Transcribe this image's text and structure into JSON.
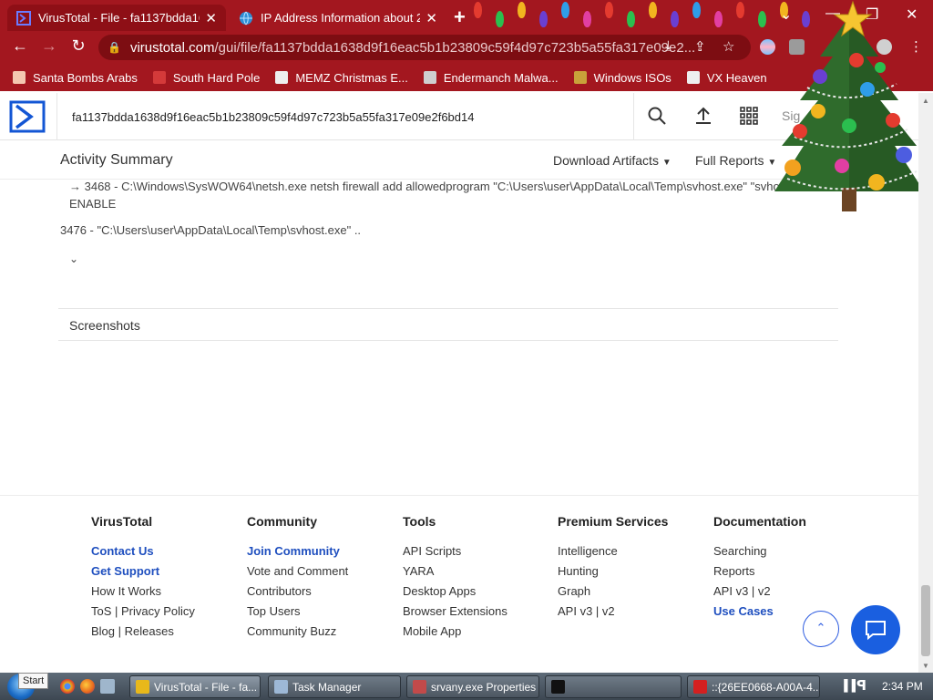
{
  "browser": {
    "tabs": [
      {
        "title": "VirusTotal - File - fa1137bdda163",
        "active": true
      },
      {
        "title": "IP Address Information about 20",
        "active": false
      }
    ],
    "new_tab": "+",
    "window_controls": {
      "minimize": "—",
      "maximize": "❐",
      "close": "✕",
      "dropdown": "⌄"
    },
    "nav": {
      "back": "←",
      "forward": "→",
      "reload": "↻"
    },
    "url_domain": "virustotal.com",
    "url_rest": "/gui/file/fa1137bdda1638d9f16eac5b1b23809c59f4d97c723b5a55fa317e09e2...",
    "bookmarks": [
      {
        "label": "Santa Bombs Arabs",
        "icon": "santa-icon",
        "color": "#f4c7b0"
      },
      {
        "label": "South Hard Pole",
        "icon": "snowflake-icon",
        "color": "#d43a3a"
      },
      {
        "label": "MEMZ Christmas E...",
        "icon": "page-icon",
        "color": "#eeeeee"
      },
      {
        "label": "Endermanch Malwa...",
        "icon": "panda-icon",
        "color": "#cfcfcf"
      },
      {
        "label": "Windows ISOs",
        "icon": "trophy-icon",
        "color": "#c9a23a"
      },
      {
        "label": "VX Heaven",
        "icon": "spider-icon",
        "color": "#eeeeee"
      }
    ]
  },
  "vt": {
    "search_value": "fa1137bdda1638d9f16eac5b1b23809c59f4d97c723b5a55fa317e09e2f6bd14",
    "signin": "Sig",
    "activity_title": "Activity Summary",
    "download_artifacts": "Download Artifacts",
    "full_reports": "Full Reports",
    "process_line1": "→ 3468 - C:\\Windows\\SysWOW64\\netsh.exe netsh firewall add allowedprogram \"C:\\Users\\user\\AppData\\Local\\Temp\\svhost.exe\" \"svhos",
    "process_line1b": "ENABLE",
    "process_line2": "3476 - \"C:\\Users\\user\\AppData\\Local\\Temp\\svhost.exe\" ..",
    "expand": "⌄",
    "screenshots": "Screenshots"
  },
  "footer": {
    "columns": [
      {
        "heading": "VirusTotal",
        "links": [
          {
            "label": "Contact Us",
            "highlight": true
          },
          {
            "label": "Get Support",
            "highlight": true
          },
          {
            "label": "How It Works",
            "highlight": false
          },
          {
            "label": "ToS | Privacy Policy",
            "highlight": false
          },
          {
            "label": "Blog | Releases",
            "highlight": false
          }
        ]
      },
      {
        "heading": "Community",
        "links": [
          {
            "label": "Join Community",
            "highlight": true
          },
          {
            "label": "Vote and Comment",
            "highlight": false
          },
          {
            "label": "Contributors",
            "highlight": false
          },
          {
            "label": "Top Users",
            "highlight": false
          },
          {
            "label": "Community Buzz",
            "highlight": false
          }
        ]
      },
      {
        "heading": "Tools",
        "links": [
          {
            "label": "API Scripts",
            "highlight": false
          },
          {
            "label": "YARA",
            "highlight": false
          },
          {
            "label": "Desktop Apps",
            "highlight": false
          },
          {
            "label": "Browser Extensions",
            "highlight": false
          },
          {
            "label": "Mobile App",
            "highlight": false
          }
        ]
      },
      {
        "heading": "Premium Services",
        "links": [
          {
            "label": "Intelligence",
            "highlight": false
          },
          {
            "label": "Hunting",
            "highlight": false
          },
          {
            "label": "Graph",
            "highlight": false
          },
          {
            "label": "API v3 | v2",
            "highlight": false
          }
        ]
      },
      {
        "heading": "Documentation",
        "links": [
          {
            "label": "Searching",
            "highlight": false
          },
          {
            "label": "Reports",
            "highlight": false
          },
          {
            "label": "API v3 | v2",
            "highlight": false
          },
          {
            "label": "Use Cases",
            "highlight": true
          }
        ]
      }
    ],
    "scroll_top": "⌃"
  },
  "taskbar": {
    "start_tooltip": "Start",
    "buttons": [
      {
        "label": "VirusTotal - File - fa...",
        "icon": "chrome-icon",
        "color": "#e8b81a",
        "active": true
      },
      {
        "label": "Task Manager",
        "icon": "taskmgr-icon",
        "color": "#9db8d6",
        "active": false
      },
      {
        "label": "srvany.exe Properties",
        "icon": "properties-icon",
        "color": "#c24a4a",
        "active": false
      },
      {
        "label": "",
        "icon": "cmd-icon",
        "color": "#111111",
        "active": false
      },
      {
        "label": "::{26EE0668-A00A-4...",
        "icon": "error-icon",
        "color": "#d42020",
        "active": false
      }
    ],
    "clock": "2:34 PM"
  },
  "colors": {
    "browser_chrome": "#a3171f",
    "accent_blue": "#1f4fbf",
    "chat_button": "#1a5fe0"
  }
}
